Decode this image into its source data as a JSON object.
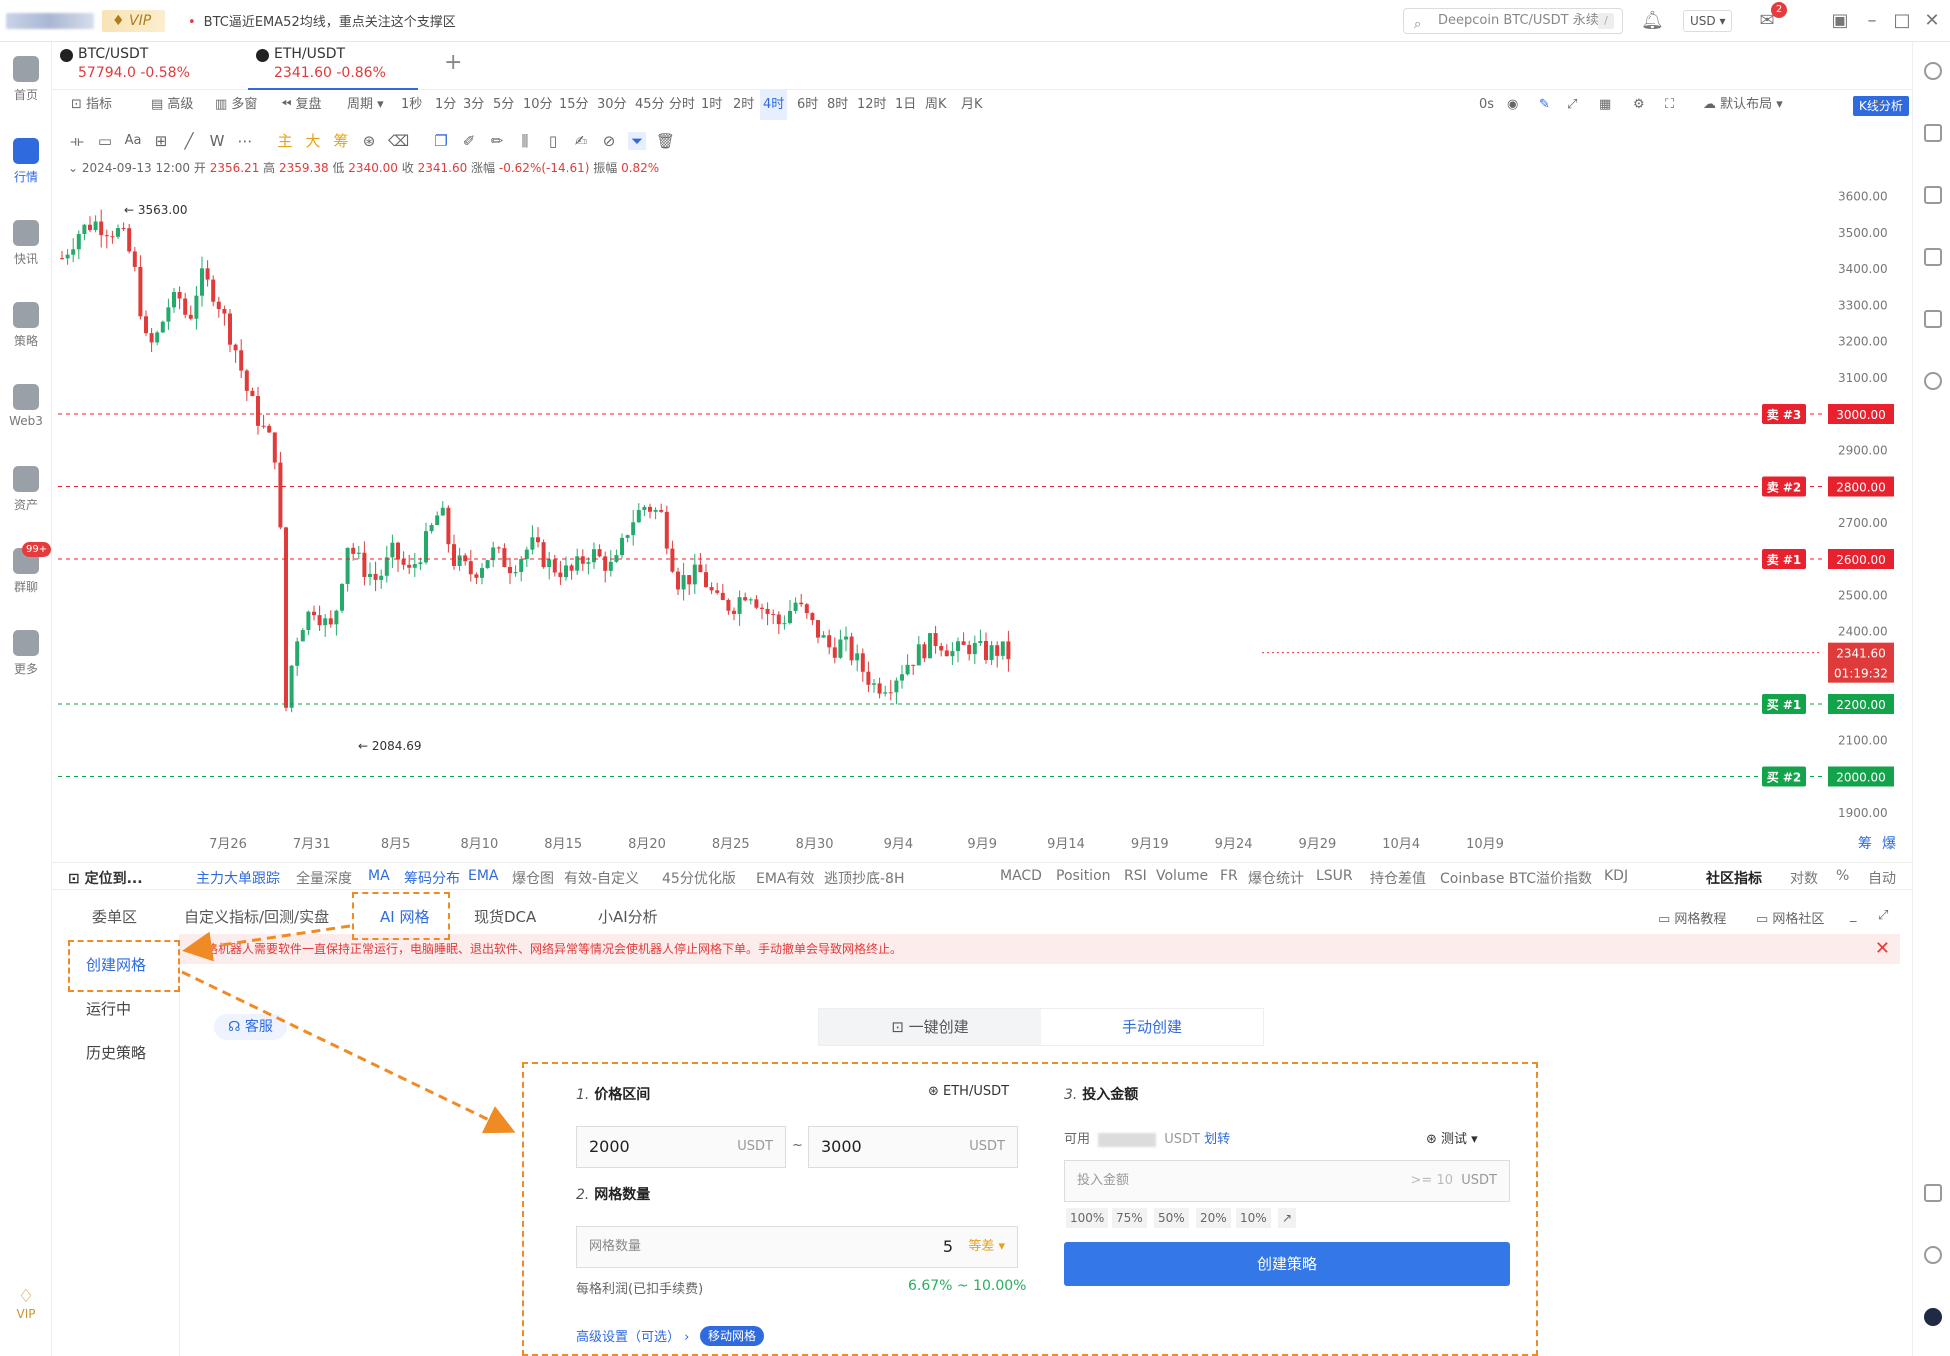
{
  "topbar": {
    "vip": "VIP",
    "news": "BTC逼近EMA52均线，重点关注这个支撑区",
    "search_placeholder": "Deepcoin BTC/USDT 永续",
    "search_key": "/",
    "currency": "USD",
    "mail_count": "2"
  },
  "leftnav": [
    {
      "label": "首页"
    },
    {
      "label": "行情"
    },
    {
      "label": "快讯"
    },
    {
      "label": "策略"
    },
    {
      "label": "Web3"
    },
    {
      "label": "资产"
    },
    {
      "label": "群聊",
      "badge": "99+"
    },
    {
      "label": "更多"
    }
  ],
  "leftnav_vip": "VIP",
  "pairs": [
    {
      "name": "BTC/USDT",
      "price": "57794.0",
      "change": "-0.58%"
    },
    {
      "name": "ETH/USDT",
      "price": "2341.60",
      "change": "-0.86%"
    }
  ],
  "toolbar": {
    "indicator": "指标",
    "advanced": "高级",
    "multi": "多窗",
    "replay": "复盘",
    "period": "周期",
    "intervals": [
      "1秒",
      "1分",
      "3分",
      "5分",
      "10分",
      "15分",
      "30分",
      "45分",
      "分时",
      "1时",
      "2时",
      "4时",
      "6时",
      "8时",
      "12时",
      "1日",
      "周K",
      "月K"
    ],
    "active_interval": "4时",
    "seconds": "0s",
    "layout": "默认布局",
    "kline": "K线分析"
  },
  "drawbar": {
    "main": "主",
    "big": "大",
    "chip": "筹"
  },
  "ohlc": {
    "date": "2024-09-13 12:00",
    "open_l": "开",
    "open": "2356.21",
    "high_l": "高",
    "high": "2359.38",
    "low_l": "低",
    "low": "2340.00",
    "close_l": "收",
    "close": "2341.60",
    "chg_l": "涨幅",
    "chg": "-0.62%(-14.61)",
    "amp_l": "振幅",
    "amp": "0.82%"
  },
  "chart_data": {
    "type": "candlestick",
    "y_ticks": [
      "3600.00",
      "3500.00",
      "3400.00",
      "3300.00",
      "3200.00",
      "3100.00",
      "3000.00",
      "2900.00",
      "2800.00",
      "2700.00",
      "2600.00",
      "2500.00",
      "2400.00",
      "2300.00",
      "2200.00",
      "2100.00",
      "2000.00",
      "1900.00"
    ],
    "ylim": [
      1880,
      3640
    ],
    "x_ticks": [
      "7月26",
      "7月31",
      "8月5",
      "8月10",
      "8月15",
      "8月20",
      "8月25",
      "8月30",
      "9月4",
      "9月9",
      "9月14",
      "9月19",
      "9月24",
      "9月29",
      "10月4",
      "10月9"
    ],
    "high_marker": "← 3563.00",
    "low_marker": "← 2084.69",
    "grid_lines": [
      {
        "label": "卖 #3",
        "value": 3000,
        "price": "3000.00",
        "side": "sell"
      },
      {
        "label": "卖 #2",
        "value": 2800,
        "price": "2800.00",
        "side": "sell"
      },
      {
        "label": "卖 #1",
        "value": 2600,
        "price": "2600.00",
        "side": "sell"
      },
      {
        "label": "买 #1",
        "value": 2200,
        "price": "2200.00",
        "side": "buy"
      },
      {
        "label": "买 #2",
        "value": 2000,
        "price": "2000.00",
        "side": "buy"
      }
    ],
    "last_price": "2341.60",
    "countdown": "01:19:32",
    "corner_labels": [
      "筹",
      "爆"
    ],
    "colors": {
      "up": "#26a96c",
      "down": "#e03b3b",
      "sell": "#e8212e",
      "buy": "#13a34a"
    }
  },
  "indicators_left": [
    "定位到...",
    "主力大单跟踪",
    "全量深度",
    "MA",
    "筹码分布",
    "EMA",
    "爆仓图",
    "有效-自定义",
    "45分优化版",
    "EMA有效",
    "逃顶抄底-8H"
  ],
  "indicators_right": [
    "MACD",
    "Position",
    "RSI",
    "Volume",
    "FR",
    "爆仓统计",
    "LSUR",
    "持仓差值",
    "Coinbase BTC溢价指数",
    "KDJ"
  ],
  "indicators_end": [
    "社区指标",
    "对数",
    "%",
    "自动"
  ],
  "panel_tabs": [
    "委单区",
    "自定义指标/回测/实盘",
    "AI 网格",
    "现货DCA",
    "小AI分析"
  ],
  "panel_right": [
    "网格教程",
    "网格社区"
  ],
  "warning": "网格机器人需要软件一直保持正常运行，电脑睡眠、退出软件、网络异常等情况会使机器人停止网格下单。手动撤单会导致网格终止。",
  "subnav": [
    "创建网格",
    "运行中",
    "历史策略"
  ],
  "kefu": "客服",
  "modes": [
    "一键创建",
    "手动创建"
  ],
  "form": {
    "s1_num": "1.",
    "s1": "价格区间",
    "pair": "ETH/USDT",
    "low": "2000",
    "high": "3000",
    "unit": "USDT",
    "tilde": "~",
    "s2_num": "2.",
    "s2": "网格数量",
    "grid_ph": "网格数量",
    "grid_n": "5",
    "grid_mode": "等差",
    "profit_l": "每格利润(已扣手续费)",
    "profit": "6.67% ~ 10.00%",
    "adv": "高级设置（可选）",
    "move": "移动网格",
    "s3_num": "3.",
    "s3": "投入金额",
    "avail_l": "可用",
    "avail_unit": "USDT",
    "transfer": "划转",
    "account": "测试",
    "amount_ph": "投入金额",
    "min": ">= 10",
    "pcts": [
      "100%",
      "75%",
      "50%",
      "20%",
      "10%"
    ],
    "create": "创建策略"
  }
}
